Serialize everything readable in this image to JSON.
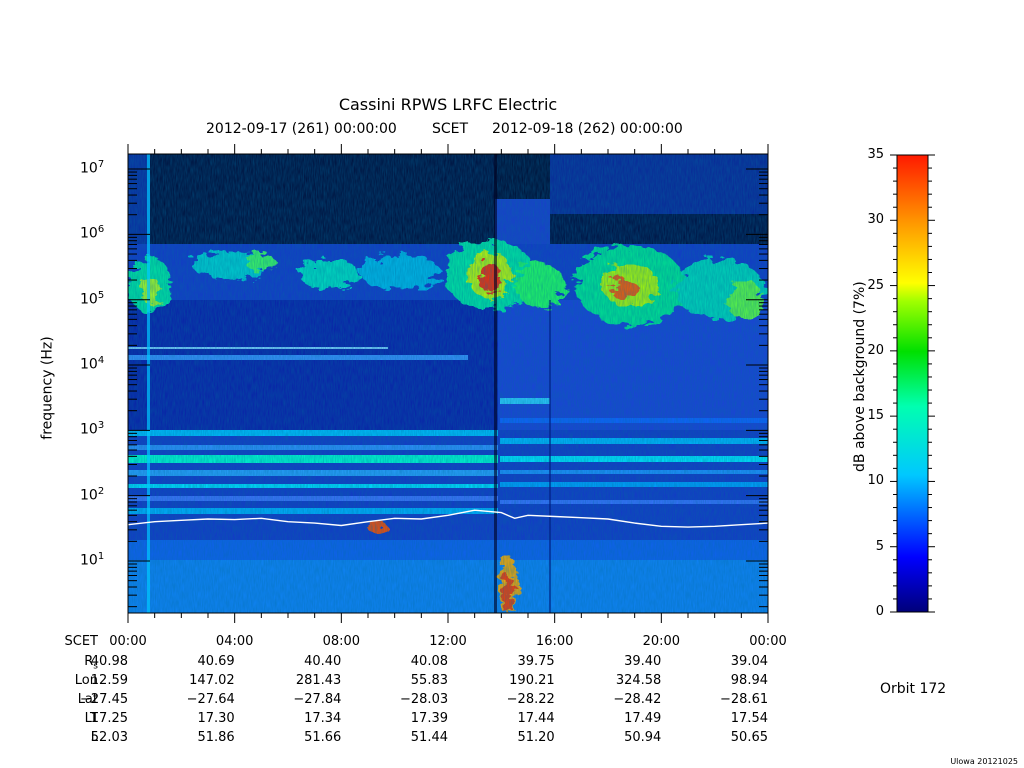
{
  "chart_data": {
    "type": "heatmap",
    "title": "Cassini RPWS LRFC Electric",
    "header": {
      "start": "2012-09-17 (261) 00:00:00",
      "frame": "SCET",
      "end": "2012-09-18 (262) 00:00:00"
    },
    "ylabel": "frequency (Hz)",
    "yscale": "log",
    "ylim": [
      1.6,
      17000000
    ],
    "y_tick_exponents": [
      1,
      2,
      3,
      4,
      5,
      6,
      7
    ],
    "xlim_hours": [
      0,
      24
    ],
    "colorbar": {
      "label": "dB above background (7%)",
      "range": [
        0,
        35
      ],
      "ticks": [
        "0",
        "5",
        "10",
        "15",
        "20",
        "25",
        "30",
        "35"
      ]
    },
    "ephemeris": {
      "row_labels": [
        "SCET",
        "Rs",
        "Lon",
        "Lat",
        "LT",
        "L"
      ],
      "times": [
        "00:00",
        "04:00",
        "08:00",
        "12:00",
        "16:00",
        "20:00",
        "00:00"
      ],
      "Rs": [
        "40.98",
        "40.69",
        "40.40",
        "40.08",
        "39.75",
        "39.40",
        "39.04"
      ],
      "Lon": [
        "12.59",
        "147.02",
        "281.43",
        "55.83",
        "190.21",
        "324.58",
        "98.94"
      ],
      "Lat": [
        "−27.45",
        "−27.64",
        "−27.84",
        "−28.03",
        "−28.22",
        "−28.42",
        "−28.61"
      ],
      "LT": [
        "17.25",
        "17.30",
        "17.34",
        "17.39",
        "17.44",
        "17.49",
        "17.54"
      ],
      "L": [
        "52.03",
        "51.86",
        "51.66",
        "51.44",
        "51.20",
        "50.94",
        "50.65"
      ]
    },
    "orbit_label": "Orbit 172",
    "footer": "Ulowa 20121025",
    "white_trace_hz": [
      [
        0,
        36
      ],
      [
        1,
        40
      ],
      [
        2,
        42
      ],
      [
        3,
        44
      ],
      [
        4,
        43
      ],
      [
        5,
        45
      ],
      [
        6,
        40
      ],
      [
        7,
        38
      ],
      [
        8,
        35
      ],
      [
        9,
        40
      ],
      [
        10,
        45
      ],
      [
        11,
        44
      ],
      [
        12,
        50
      ],
      [
        13,
        60
      ],
      [
        14,
        55
      ],
      [
        14.5,
        45
      ],
      [
        15,
        50
      ],
      [
        16,
        48
      ],
      [
        17,
        46
      ],
      [
        18,
        44
      ],
      [
        19,
        38
      ],
      [
        20,
        34
      ],
      [
        21,
        33
      ],
      [
        22,
        34
      ],
      [
        23,
        36
      ],
      [
        24,
        38
      ]
    ]
  }
}
